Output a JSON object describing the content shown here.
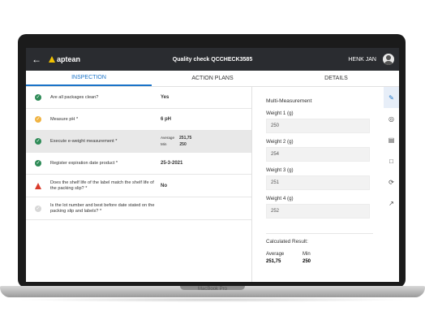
{
  "header": {
    "back_icon": "arrow-left-icon",
    "brand": "aptean",
    "title": "Quality check  QCCHECK3585",
    "user": "HENK JAN"
  },
  "tabs": [
    {
      "label": "INSPECTION"
    },
    {
      "label": "ACTION PLANS"
    },
    {
      "label": "DETAILS"
    }
  ],
  "checks": [
    {
      "status": "ok",
      "question": "Are all packages clean?",
      "answer": "Yes"
    },
    {
      "status": "warn",
      "question": "Measure pH *",
      "answer": "6 pH"
    },
    {
      "status": "ok",
      "question": "Execute e-weight measurement *",
      "avg_label": "Average",
      "avg_value": "251,75",
      "min_label": "Min",
      "min_value": "250"
    },
    {
      "status": "ok",
      "question": "Register expiration date product *",
      "answer": "25-3-2021"
    },
    {
      "status": "error",
      "question": "Does the shelf life of the label match the shelf life of the packing slip? *",
      "answer": "No"
    },
    {
      "status": "pending",
      "question": "Is the lot number and best before date stated on the packing slip and labels? *",
      "answer": ""
    }
  ],
  "panel": {
    "title": "Multi-Measurement",
    "weights": [
      {
        "label": "Weight 1 (g)",
        "value": "250"
      },
      {
        "label": "Weight 2 (g)",
        "value": "254"
      },
      {
        "label": "Weight 3 (g)",
        "value": "251"
      },
      {
        "label": "Weight 4 (g)",
        "value": "252"
      }
    ],
    "calc_title": "Calculated Result:",
    "avg_label": "Average",
    "avg_value": "251,75",
    "min_label": "Min",
    "min_value": "250"
  },
  "rail_icons": [
    "measure-icon",
    "target-icon",
    "id-card-icon",
    "comment-icon",
    "refresh-icon",
    "chart-icon"
  ],
  "laptop_label": "MacBook Pro",
  "colors": {
    "accent": "#1a73c8",
    "header": "#2a2c30",
    "ok": "#2e8b57",
    "warn": "#f0b341",
    "error": "#d93b2b"
  }
}
